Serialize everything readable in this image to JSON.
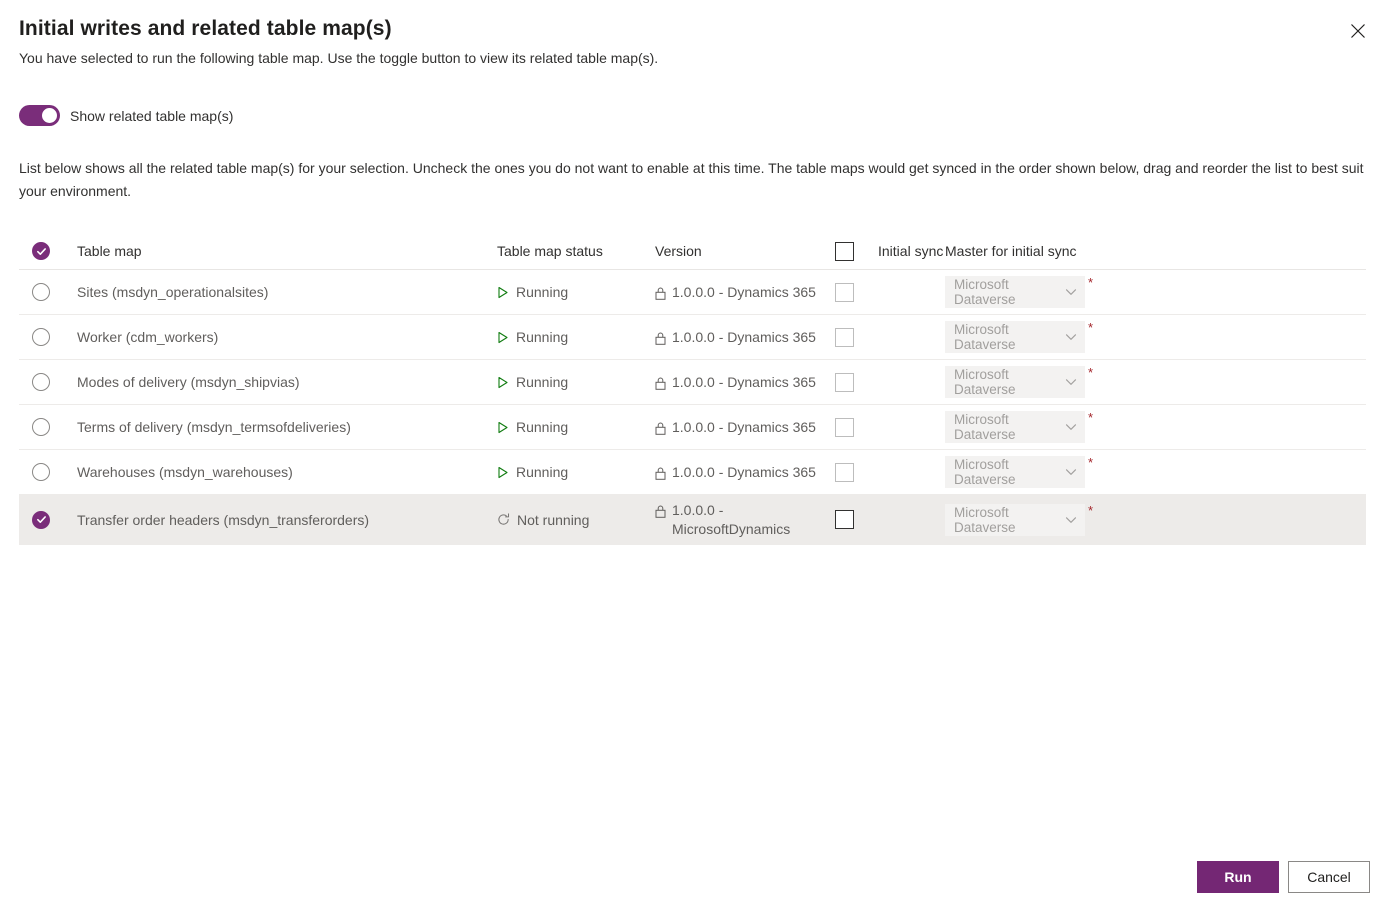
{
  "dialog": {
    "title": "Initial writes and related table map(s)",
    "subtitle": "You have selected to run the following table map. Use the toggle button to view its related table map(s).",
    "close_label": "Close",
    "description": "List below shows all the related table map(s) for your selection. Uncheck the ones you do not want to enable at this time. The table maps would get synced in the order shown below, drag and reorder the list to best suit your environment."
  },
  "toggle": {
    "label": "Show related table map(s)",
    "on": true,
    "color": "#7A2D7A"
  },
  "table": {
    "headers": {
      "select": "",
      "table_map": "Table map",
      "table_map_status": "Table map status",
      "version": "Version",
      "initial_sync": "Initial sync",
      "master_for_initial_sync": "Master for initial sync"
    },
    "rows": [
      {
        "name": "Sites (msdyn_operationalsites)",
        "selected": false,
        "status": "Running",
        "status_icon": "play-icon",
        "version": "1.0.0.0 - Dynamics 365",
        "version_icon": "lock-icon",
        "initial_sync_checked": false,
        "initial_sync_enabled": false,
        "master": "Microsoft Dataverse",
        "required": "*"
      },
      {
        "name": "Worker (cdm_workers)",
        "selected": false,
        "status": "Running",
        "status_icon": "play-icon",
        "version": "1.0.0.0 - Dynamics 365",
        "version_icon": "lock-icon",
        "initial_sync_checked": false,
        "initial_sync_enabled": false,
        "master": "Microsoft Dataverse",
        "required": "*"
      },
      {
        "name": "Modes of delivery (msdyn_shipvias)",
        "selected": false,
        "status": "Running",
        "status_icon": "play-icon",
        "version": "1.0.0.0 - Dynamics 365",
        "version_icon": "lock-icon",
        "initial_sync_checked": false,
        "initial_sync_enabled": false,
        "master": "Microsoft Dataverse",
        "required": "*"
      },
      {
        "name": "Terms of delivery (msdyn_termsofdeliveries)",
        "selected": false,
        "status": "Running",
        "status_icon": "play-icon",
        "version": "1.0.0.0 - Dynamics 365",
        "version_icon": "lock-icon",
        "initial_sync_checked": false,
        "initial_sync_enabled": false,
        "master": "Microsoft Dataverse",
        "required": "*"
      },
      {
        "name": "Warehouses (msdyn_warehouses)",
        "selected": false,
        "status": "Running",
        "status_icon": "play-icon",
        "version": "1.0.0.0 - Dynamics 365",
        "version_icon": "lock-icon",
        "initial_sync_checked": false,
        "initial_sync_enabled": false,
        "master": "Microsoft Dataverse",
        "required": "*"
      },
      {
        "name": "Transfer order headers (msdyn_transferorders)",
        "selected": true,
        "status": "Not running",
        "status_icon": "refresh-icon",
        "version": "1.0.0.0 - MicrosoftDynamics",
        "version_icon": "lock-icon",
        "initial_sync_checked": false,
        "initial_sync_enabled": true,
        "master": "Microsoft Dataverse",
        "required": "*"
      }
    ]
  },
  "footer": {
    "run_label": "Run",
    "cancel_label": "Cancel",
    "primary_color": "#742774"
  }
}
